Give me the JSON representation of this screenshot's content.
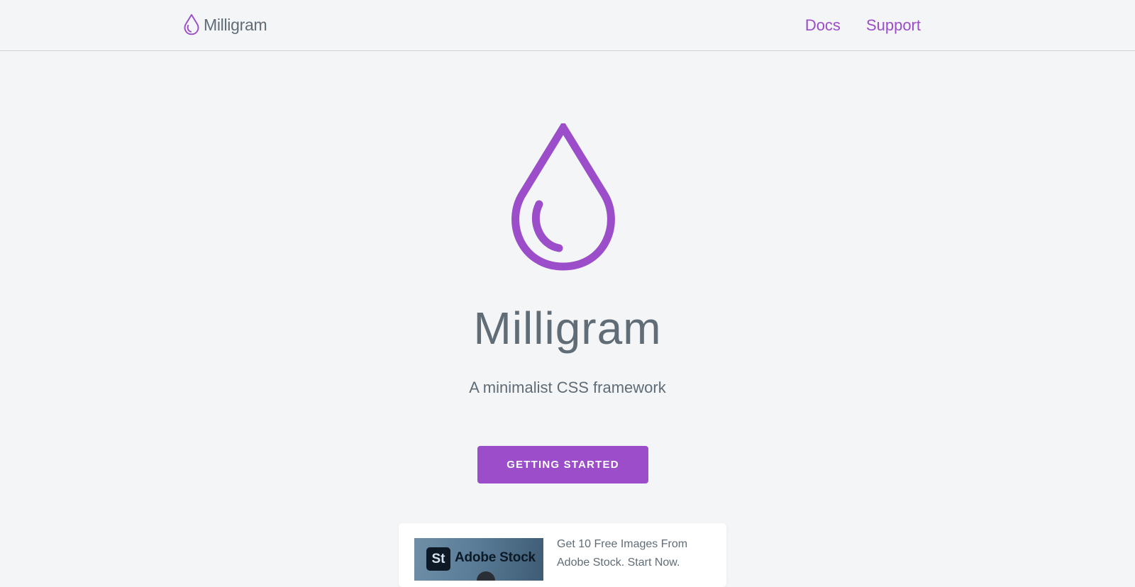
{
  "nav": {
    "brand_name": "Milligram",
    "links": [
      {
        "label": "Docs"
      },
      {
        "label": "Support"
      }
    ]
  },
  "hero": {
    "title": "Milligram",
    "subtitle": "A minimalist CSS framework",
    "cta_label": "Getting Started"
  },
  "ad": {
    "badge": "St",
    "brand": "Adobe Stock",
    "text": "Get 10 Free Images From Adobe Stock. Start Now."
  },
  "colors": {
    "accent": "#9b4dca",
    "text": "#606c76",
    "background": "#f4f5f6"
  },
  "icons": {
    "logo": "milligram-drop-icon"
  }
}
